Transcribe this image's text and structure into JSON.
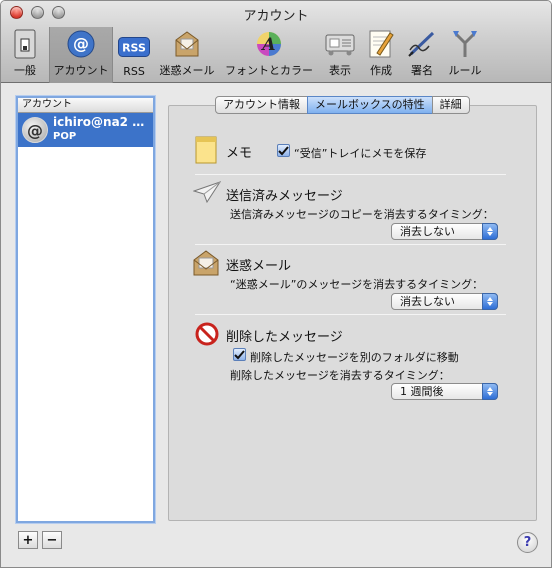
{
  "window": {
    "title": "アカウント"
  },
  "toolbar": {
    "items": [
      {
        "label": "一般",
        "icon": "general-switch-icon"
      },
      {
        "label": "アカウント",
        "icon": "at-sign-icon",
        "selected": true
      },
      {
        "label": "RSS",
        "icon": "rss-icon"
      },
      {
        "label": "迷惑メール",
        "icon": "junk-mail-icon"
      },
      {
        "label": "フォントとカラー",
        "icon": "font-color-icon"
      },
      {
        "label": "表示",
        "icon": "display-icon"
      },
      {
        "label": "作成",
        "icon": "compose-icon"
      },
      {
        "label": "署名",
        "icon": "signature-icon"
      },
      {
        "label": "ルール",
        "icon": "rules-icon"
      }
    ]
  },
  "accounts": {
    "header": "アカウント",
    "items": [
      {
        "name": "ichiro@na2 …",
        "type": "POP"
      }
    ],
    "add_label": "+",
    "remove_label": "−"
  },
  "tabs": [
    {
      "label": "アカウント情報"
    },
    {
      "label": "メールボックスの特性",
      "active": true
    },
    {
      "label": "詳細"
    }
  ],
  "memo": {
    "title": "メモ",
    "checkbox_label": "“受信”トレイにメモを保存",
    "checked": true
  },
  "sent": {
    "title": "送信済みメッセージ",
    "desc": "送信済みメッセージのコピーを消去するタイミング：",
    "value": "消去しない"
  },
  "junk": {
    "title": "迷惑メール",
    "desc": "“迷惑メール”のメッセージを消去するタイミング：",
    "value": "消去しない"
  },
  "trash": {
    "title": "削除したメッセージ",
    "checkbox_label": "削除したメッセージを別のフォルダに移動",
    "checked": true,
    "desc": "削除したメッセージを消去するタイミング：",
    "value": "1 週間後"
  },
  "help_label": "?",
  "colors": {
    "accent": "#3c73c9",
    "tab_active": "#7fb0ef"
  }
}
